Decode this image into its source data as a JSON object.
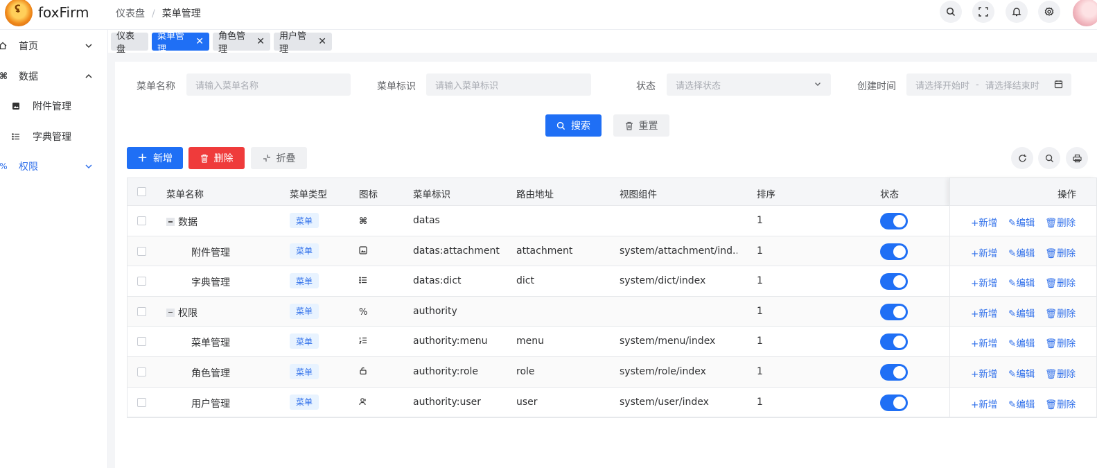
{
  "header": {
    "brand": "foxFirm",
    "breadcrumb": [
      "仪表盘",
      "菜单管理"
    ],
    "separator": "/"
  },
  "sidebar": {
    "items": [
      {
        "label": "首页",
        "icon": "home-icon",
        "chevron": "down"
      },
      {
        "label": "数据",
        "icon": "command-icon",
        "chevron": "up"
      },
      {
        "label": "附件管理",
        "icon": "image-icon"
      },
      {
        "label": "字典管理",
        "icon": "list-icon"
      },
      {
        "label": "权限",
        "icon": "percent-icon",
        "chevron": "down",
        "active": true
      }
    ]
  },
  "tabs": [
    {
      "label": "仪表盘",
      "closable": false
    },
    {
      "label": "菜单管理",
      "closable": true,
      "active": true
    },
    {
      "label": "角色管理",
      "closable": true
    },
    {
      "label": "用户管理",
      "closable": true
    }
  ],
  "filters": {
    "name_label": "菜单名称",
    "name_placeholder": "请输入菜单名称",
    "key_label": "菜单标识",
    "key_placeholder": "请输入菜单标识",
    "status_label": "状态",
    "status_placeholder": "请选择状态",
    "created_label": "创建时间",
    "start_placeholder": "请选择开始时",
    "range_sep": "-",
    "end_placeholder": "请选择结束时"
  },
  "actions": {
    "search": "搜索",
    "reset": "重置",
    "add": "新增",
    "delete": "删除",
    "collapse": "折叠"
  },
  "table": {
    "columns": [
      "菜单名称",
      "菜单类型",
      "图标",
      "菜单标识",
      "路由地址",
      "视图组件",
      "排序",
      "状态",
      "操作"
    ],
    "rows": [
      {
        "name": "数据",
        "type": "菜单",
        "icon": "command-icon",
        "key": "datas",
        "route": "",
        "component": "",
        "sort": "1",
        "enabled": true,
        "parent": true
      },
      {
        "name": "附件管理",
        "type": "菜单",
        "icon": "image-icon",
        "key": "datas:attachment",
        "route": "attachment",
        "component": "system/attachment/ind...",
        "sort": "1",
        "enabled": true,
        "parent": false
      },
      {
        "name": "字典管理",
        "type": "菜单",
        "icon": "list-icon",
        "key": "datas:dict",
        "route": "dict",
        "component": "system/dict/index",
        "sort": "1",
        "enabled": true,
        "parent": false
      },
      {
        "name": "权限",
        "type": "菜单",
        "icon": "percent-icon",
        "key": "authority",
        "route": "",
        "component": "",
        "sort": "1",
        "enabled": true,
        "parent": true
      },
      {
        "name": "菜单管理",
        "type": "菜单",
        "icon": "list-ordered-icon",
        "key": "authority:menu",
        "route": "menu",
        "component": "system/menu/index",
        "sort": "1",
        "enabled": true,
        "parent": false
      },
      {
        "name": "角色管理",
        "type": "菜单",
        "icon": "role-icon",
        "key": "authority:role",
        "route": "role",
        "component": "system/role/index",
        "sort": "1",
        "enabled": true,
        "parent": false
      },
      {
        "name": "用户管理",
        "type": "菜单",
        "icon": "user-icon",
        "key": "authority:user",
        "route": "user",
        "component": "system/user/index",
        "sort": "1",
        "enabled": true,
        "parent": false
      }
    ],
    "row_ops": {
      "add": "新增",
      "edit": "编辑",
      "delete": "删除"
    }
  },
  "colors": {
    "primary": "#1f6ff5",
    "danger": "#ef3b3b",
    "tag_bg": "#e8f3ff"
  }
}
